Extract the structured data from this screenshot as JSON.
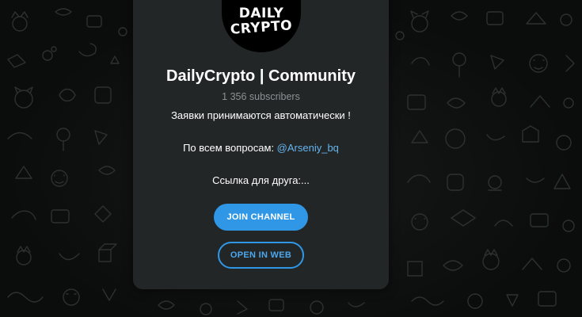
{
  "channel": {
    "avatar_text_line1": "DAILY",
    "avatar_text_line2": "CRYPTO",
    "title": "DailyCrypto | Community",
    "subscribers": "1 356 subscribers",
    "description_line1": "Заявки принимаются автоматически !",
    "description_line2_prefix": "По всем вопросам: ",
    "description_line2_mention": "@Arseniy_bq",
    "description_line3": "Ссылка для друга:..."
  },
  "actions": {
    "join_label": "JOIN CHANNEL",
    "web_label": "OPEN IN WEB"
  },
  "colors": {
    "accent": "#2f97e6",
    "card": "#232627",
    "background": "#0b0c0c",
    "link": "#64b5ef"
  }
}
